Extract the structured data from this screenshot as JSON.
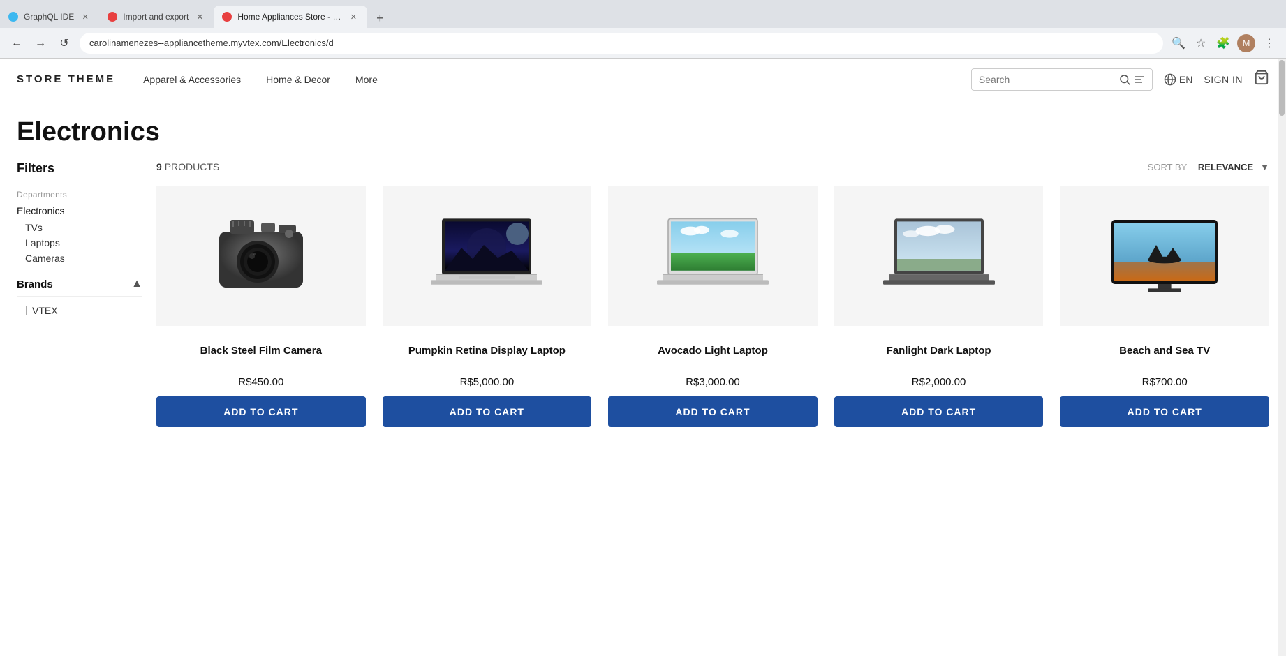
{
  "browser": {
    "tabs": [
      {
        "id": "tab1",
        "title": "GraphQL IDE",
        "favicon_color": "#3db8f0",
        "active": false
      },
      {
        "id": "tab2",
        "title": "Import and export",
        "favicon_color": "#e84040",
        "active": false
      },
      {
        "id": "tab3",
        "title": "Home Appliances Store - Electro...",
        "favicon_color": "#e84040",
        "active": true
      }
    ],
    "new_tab_label": "+",
    "address": "carolinamenezes--appliancetheme.myvtex.com/Electronics/d",
    "actions": {
      "back": "←",
      "forward": "→",
      "reload": "↺",
      "zoom": "🔍",
      "bookmark": "☆",
      "extensions": "🧩",
      "more": "⋮"
    }
  },
  "store": {
    "logo": "STORE THEME",
    "nav_links": [
      {
        "label": "Apparel & Accessories"
      },
      {
        "label": "Home & Decor"
      },
      {
        "label": "More"
      }
    ],
    "search_placeholder": "Search",
    "language": "EN",
    "sign_in": "SIGN IN",
    "cart_icon": "🛒"
  },
  "page": {
    "title": "Electronics",
    "filters_label": "Filters",
    "departments_label": "Departments",
    "category": "Electronics",
    "subcategories": [
      "TVs",
      "Laptops",
      "Cameras"
    ],
    "brands_label": "Brands",
    "brands": [
      {
        "name": "VTEX",
        "checked": false
      }
    ],
    "products_count": "9",
    "products_unit": "PRODUCTS",
    "sort_label": "SORT BY",
    "sort_value": "RELEVANCE",
    "products": [
      {
        "id": "p1",
        "name": "Black Steel Film Camera",
        "price": "R$450.00",
        "add_to_cart": "ADD TO CART",
        "image_type": "camera"
      },
      {
        "id": "p2",
        "name": "Pumpkin Retina Display Laptop",
        "price": "R$5,000.00",
        "add_to_cart": "ADD TO CART",
        "image_type": "laptop_dark"
      },
      {
        "id": "p3",
        "name": "Avocado Light Laptop",
        "price": "R$3,000.00",
        "add_to_cart": "ADD TO CART",
        "image_type": "laptop_light"
      },
      {
        "id": "p4",
        "name": "Fanlight Dark Laptop",
        "price": "R$2,000.00",
        "add_to_cart": "ADD TO CART",
        "image_type": "laptop_dark2"
      },
      {
        "id": "p5",
        "name": "Beach and Sea TV",
        "price": "R$700.00",
        "add_to_cart": "ADD TO CART",
        "image_type": "tv"
      }
    ]
  }
}
